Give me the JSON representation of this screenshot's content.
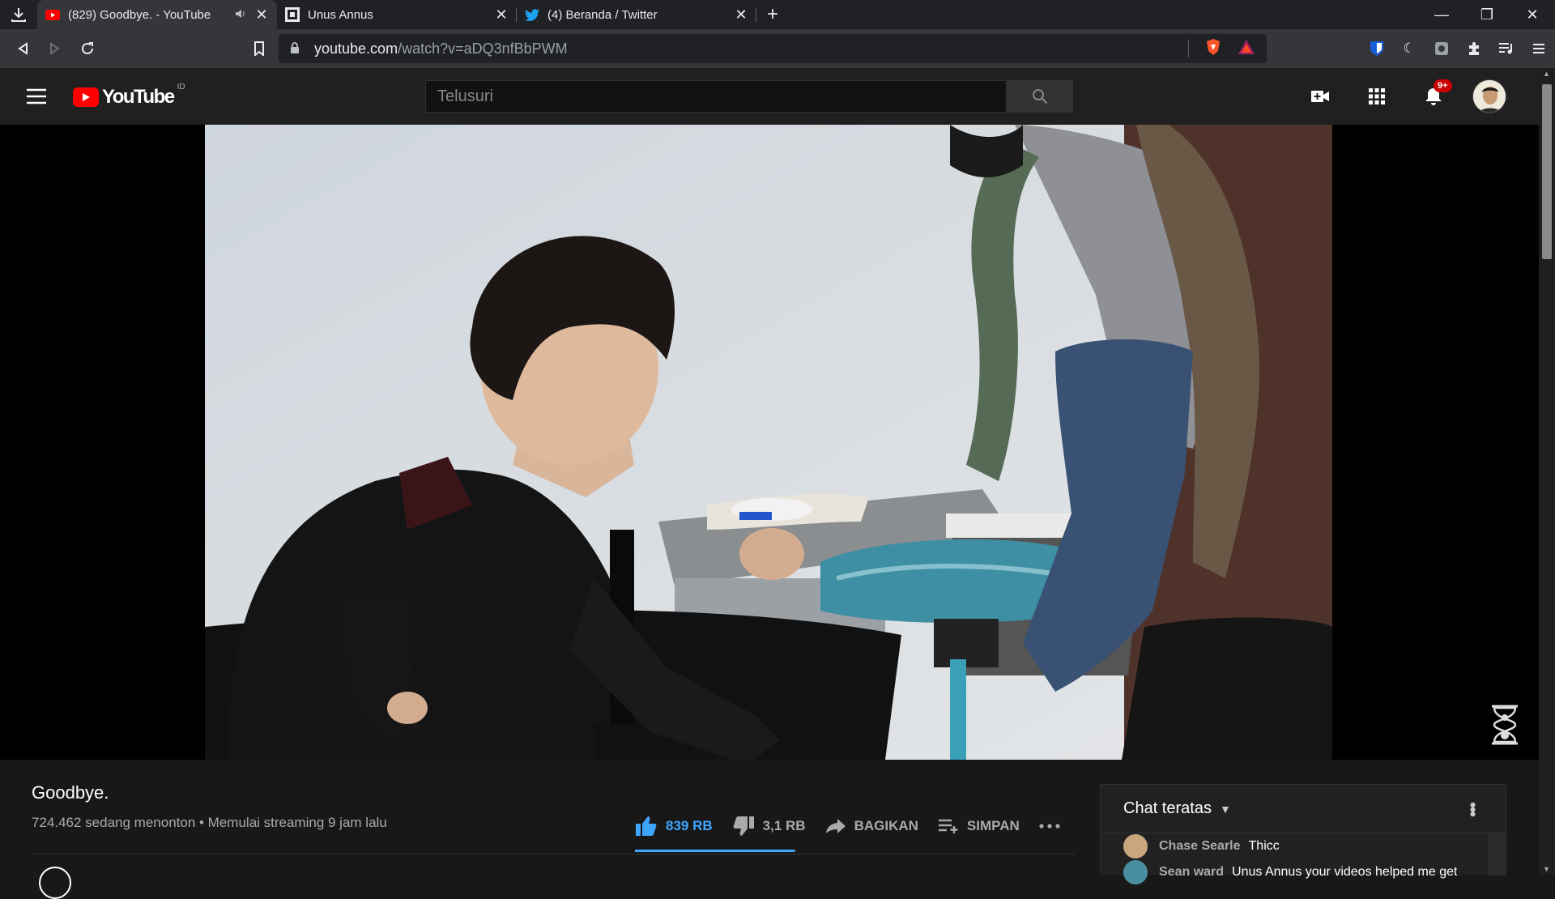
{
  "browser": {
    "tabs": [
      {
        "title": "(829) Goodbye. - YouTube",
        "active": true
      },
      {
        "title": "Unus Annus",
        "active": false
      },
      {
        "title": "(4) Beranda / Twitter",
        "active": false
      }
    ],
    "url_host": "youtube.com",
    "url_path": "/watch?v=aDQ3nfBbPWM"
  },
  "masthead": {
    "logo_text": "YouTube",
    "country_code": "ID",
    "search_placeholder": "Telusuri",
    "notification_count": "9+"
  },
  "video": {
    "title": "Goodbye.",
    "info": "724.462 sedang menonton • Memulai streaming 9 jam lalu",
    "like_count": "839 RB",
    "dislike_count": "3,1 RB",
    "share_label": "BAGIKAN",
    "save_label": "SIMPAN",
    "like_ratio": 0.996
  },
  "chat": {
    "header": "Chat teratas",
    "messages": [
      {
        "author": "Chase Searle",
        "text": "Thicc"
      },
      {
        "author": "Sean ward",
        "text": "Unus Annus your videos helped me get"
      }
    ]
  },
  "colors": {
    "accent": "#3ea6ff",
    "brand": "#ff0000",
    "background": "#181818"
  }
}
